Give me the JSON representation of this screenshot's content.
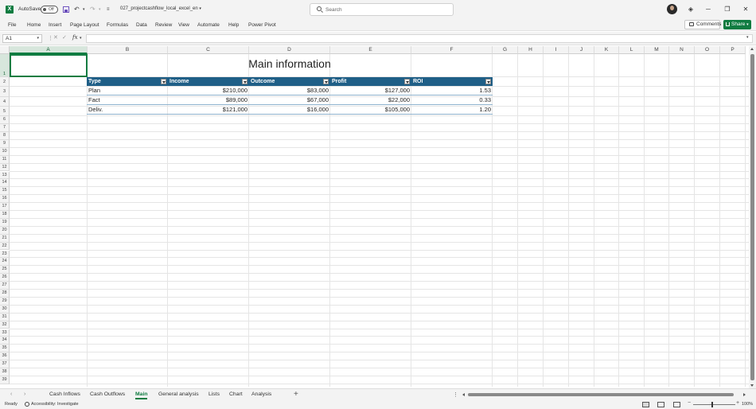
{
  "app": {
    "autosave_label": "AutoSave",
    "autosave_state": "Off",
    "filename": "027_projectcashflow_local_excel_en",
    "search_placeholder": "Search",
    "accent_color": "#107c41"
  },
  "ribbon": {
    "tabs": [
      "File",
      "Home",
      "Insert",
      "Page Layout",
      "Formulas",
      "Data",
      "Review",
      "View",
      "Automate",
      "Help",
      "Power Pivot"
    ],
    "comments_label": "Comments",
    "share_label": "Share"
  },
  "formula_bar": {
    "name_box": "A1",
    "fx_label": "fx",
    "formula": ""
  },
  "grid": {
    "columns": [
      "A",
      "B",
      "C",
      "D",
      "E",
      "F",
      "G",
      "H",
      "I",
      "J",
      "K",
      "L",
      "M",
      "N",
      "O",
      "P"
    ],
    "rows": [
      "1",
      "2",
      "3",
      "4",
      "5",
      "6",
      "7",
      "8",
      "9",
      "10",
      "11",
      "12",
      "13",
      "14",
      "15",
      "16",
      "17",
      "18",
      "19",
      "20",
      "21",
      "22",
      "23",
      "24",
      "25",
      "26",
      "27",
      "28",
      "29",
      "30",
      "31",
      "32",
      "33",
      "34",
      "35",
      "36",
      "37",
      "38",
      "39"
    ],
    "selected_cell": "A1"
  },
  "sheet": {
    "title": "Main information",
    "table_header_color": "#1f5f87",
    "headers": [
      "Type",
      "Income",
      "Outcome",
      "Profit",
      "ROI"
    ],
    "rows": [
      [
        "Plan",
        "$210,000",
        "$83,000",
        "$127,000",
        "1.53"
      ],
      [
        "Fact",
        "$89,000",
        "$67,000",
        "$22,000",
        "0.33"
      ],
      [
        "Deliv.",
        "$121,000",
        "$16,000",
        "$105,000",
        "1.20"
      ]
    ]
  },
  "sheet_tabs": {
    "tabs": [
      "Cash Inflows",
      "Cash Outflows",
      "Main",
      "General analysis",
      "Lists",
      "Chart",
      "Analysis"
    ],
    "active": "Main",
    "add_symbol": "+"
  },
  "status": {
    "ready": "Ready",
    "accessibility": "Accessibility: Investigate",
    "zoom": "100%"
  }
}
